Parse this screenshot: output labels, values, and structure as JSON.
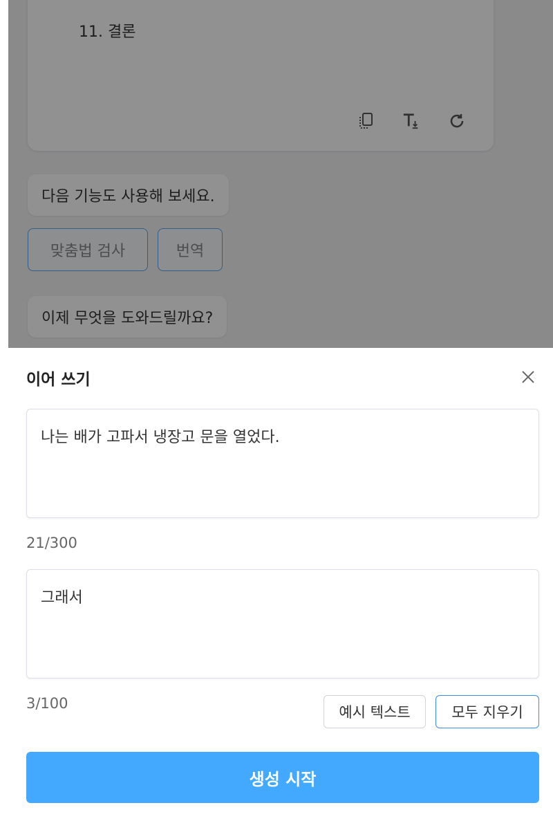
{
  "chat": {
    "card_text": "11. 결론",
    "suggestion_text": "다음 기능도 사용해 보세요.",
    "chips": [
      "맞춤법 검사",
      "번역"
    ],
    "prompt_text": "이제 무엇을 도와드릴까요?",
    "tools": [
      "copy-icon",
      "insert-text-icon",
      "refresh-icon"
    ]
  },
  "sheet": {
    "title": "이어 쓰기",
    "input1": {
      "value": "나는 배가 고파서 냉장고 문을 열었다.",
      "counter": "21/300"
    },
    "input2": {
      "value": "그래서",
      "counter": "3/100"
    },
    "example_button": "예시 텍스트",
    "clear_button": "모두 지우기",
    "generate_button": "생성 시작"
  },
  "colors": {
    "primary": "#42a9ff",
    "chip_border": "#5aa6ee",
    "overlay": "rgba(0,0,0,0.43)"
  }
}
